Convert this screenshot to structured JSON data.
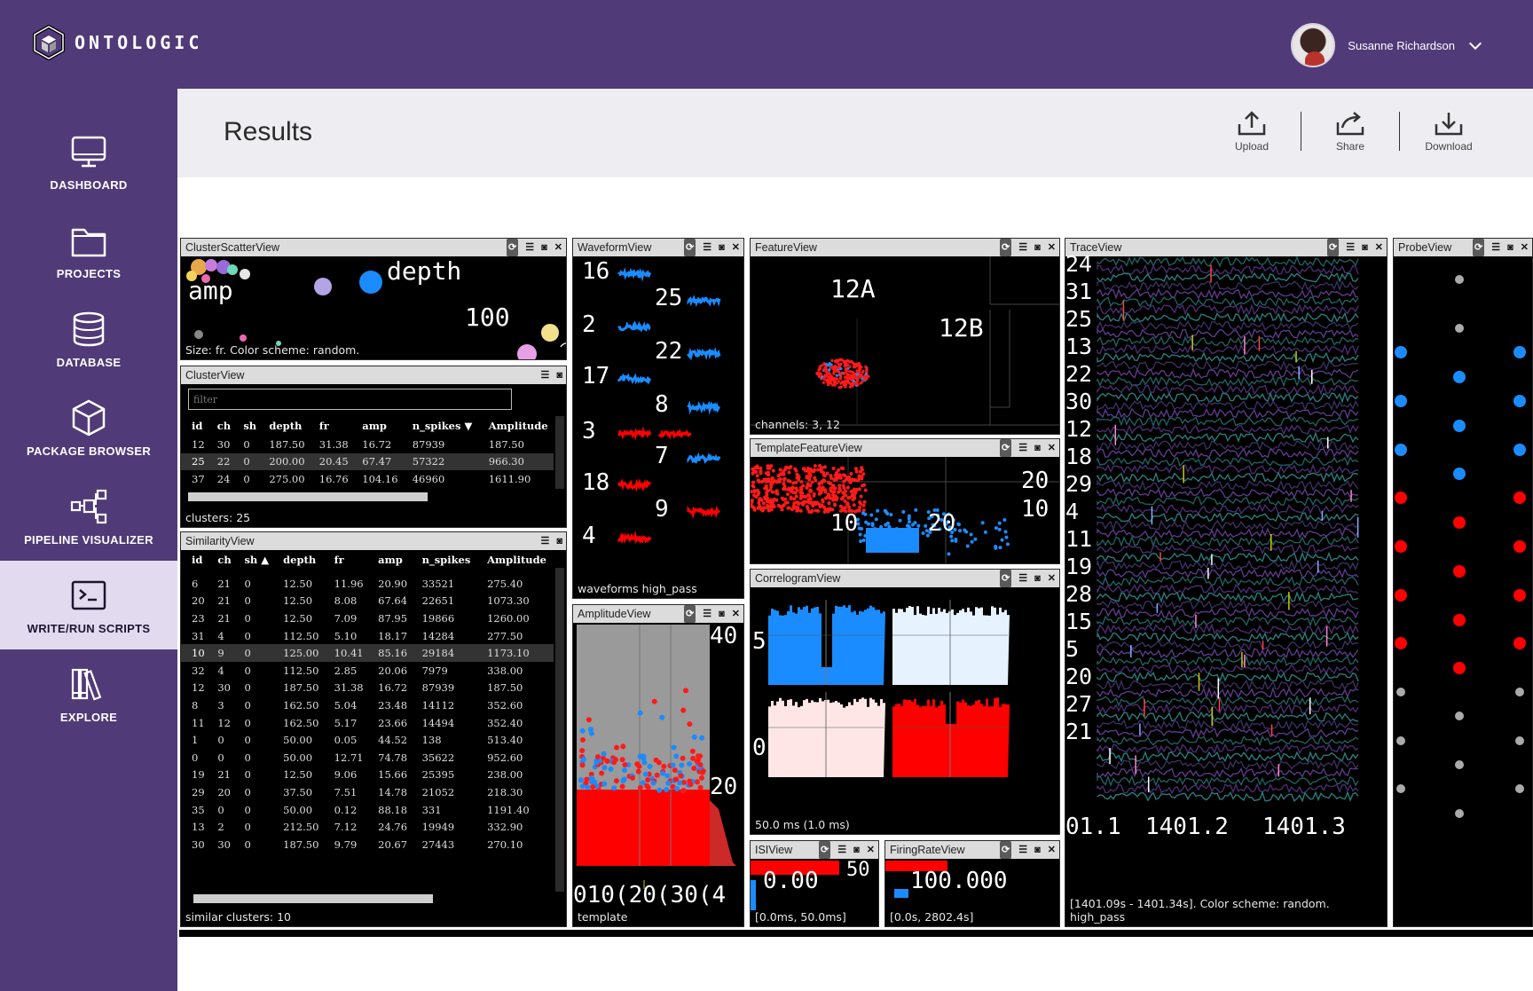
{
  "brand": {
    "name": "ONTOLOGIC"
  },
  "user": {
    "name": "Susanne Richardson"
  },
  "nav": [
    {
      "label": "DASHBOARD",
      "icon": "monitor-icon"
    },
    {
      "label": "PROJECTS",
      "icon": "folder-icon"
    },
    {
      "label": "DATABASE",
      "icon": "database-icon"
    },
    {
      "label": "PACKAGE BROWSER",
      "icon": "box-icon"
    },
    {
      "label": "PIPELINE VISUALIZER",
      "icon": "pipeline-icon"
    },
    {
      "label": "WRITE/RUN SCRIPTS",
      "icon": "terminal-icon",
      "active": true
    },
    {
      "label": "EXPLORE",
      "icon": "library-icon"
    }
  ],
  "page": {
    "title": "Results"
  },
  "actions": {
    "upload": "Upload",
    "share": "Share",
    "download": "Download"
  },
  "panels": {
    "cluster_scatter": {
      "title": "ClusterScatterView",
      "footer": "Size: fr. Color scheme: random.",
      "labels": [
        "depth",
        "amp",
        "100"
      ]
    },
    "cluster": {
      "title": "ClusterView",
      "filter_placeholder": "filter",
      "footer": "clusters: 25",
      "columns": [
        "id",
        "ch",
        "sh",
        "depth",
        "fr",
        "amp",
        "n_spikes ▼",
        "Amplitude"
      ],
      "rows": [
        [
          "12",
          "30",
          "0",
          "187.50",
          "31.38",
          "16.72",
          "87939",
          "187.50"
        ],
        [
          "25",
          "22",
          "0",
          "200.00",
          "20.45",
          "67.47",
          "57322",
          "966.30"
        ],
        [
          "37",
          "24",
          "0",
          "275.00",
          "16.76",
          "104.16",
          "46960",
          "1611.90"
        ]
      ]
    },
    "similarity": {
      "title": "SimilarityView",
      "footer": "similar clusters: 10",
      "columns": [
        "id",
        "ch",
        "sh ▲",
        "depth",
        "fr",
        "amp",
        "n_spikes",
        "Amplitude"
      ],
      "rows": [
        [
          "6",
          "21",
          "0",
          "12.50",
          "11.96",
          "20.90",
          "33521",
          "275.40"
        ],
        [
          "20",
          "21",
          "0",
          "12.50",
          "8.08",
          "67.64",
          "22651",
          "1073.30"
        ],
        [
          "23",
          "21",
          "0",
          "12.50",
          "7.09",
          "87.95",
          "19866",
          "1260.00"
        ],
        [
          "31",
          "4",
          "0",
          "112.50",
          "5.10",
          "18.17",
          "14284",
          "277.50"
        ],
        [
          "10",
          "9",
          "0",
          "125.00",
          "10.41",
          "85.16",
          "29184",
          "1173.10"
        ],
        [
          "32",
          "4",
          "0",
          "112.50",
          "2.85",
          "20.06",
          "7979",
          "338.00"
        ],
        [
          "12",
          "30",
          "0",
          "187.50",
          "31.38",
          "16.72",
          "87939",
          "187.50"
        ],
        [
          "8",
          "3",
          "0",
          "162.50",
          "5.04",
          "23.48",
          "14112",
          "352.60"
        ],
        [
          "11",
          "12",
          "0",
          "162.50",
          "5.17",
          "23.66",
          "14494",
          "352.40"
        ],
        [
          "1",
          "0",
          "0",
          "50.00",
          "0.05",
          "44.52",
          "138",
          "513.40"
        ],
        [
          "0",
          "0",
          "0",
          "50.00",
          "12.71",
          "74.78",
          "35622",
          "952.60"
        ],
        [
          "19",
          "21",
          "0",
          "12.50",
          "9.06",
          "15.66",
          "25395",
          "238.00"
        ],
        [
          "29",
          "20",
          "0",
          "37.50",
          "7.51",
          "14.78",
          "21052",
          "218.30"
        ],
        [
          "35",
          "0",
          "0",
          "50.00",
          "0.12",
          "88.18",
          "331",
          "1191.40"
        ],
        [
          "13",
          "2",
          "0",
          "212.50",
          "7.12",
          "24.76",
          "19949",
          "332.90"
        ],
        [
          "30",
          "30",
          "0",
          "187.50",
          "9.79",
          "20.67",
          "27443",
          "270.10"
        ]
      ]
    },
    "waveform": {
      "title": "WaveformView",
      "footer": "waveforms high_pass",
      "channels": [
        "16",
        "25",
        "2",
        "22",
        "17",
        "8",
        "3",
        "7",
        "18",
        "9",
        "4"
      ]
    },
    "feature": {
      "title": "FeatureView",
      "footer": "channels: 3, 12",
      "labels": [
        "12A",
        "12B"
      ]
    },
    "template_feature": {
      "title": "TemplateFeatureView",
      "labels": [
        "20",
        "10",
        "10",
        "20"
      ]
    },
    "amplitude": {
      "title": "AmplitudeView",
      "footer": "template",
      "labels": [
        "40",
        "20"
      ],
      "axis": "010(20(30(4"
    },
    "correlogram": {
      "title": "CorrelogramView",
      "footer": "50.0 ms (1.0 ms)",
      "labels": [
        "5",
        "0"
      ]
    },
    "isi": {
      "title": "ISIView",
      "footer": "[0.0ms, 50.0ms]",
      "labels": [
        "0.00",
        "50"
      ]
    },
    "firing_rate": {
      "title": "FiringRateView",
      "footer": "[0.0s, 2802.4s]",
      "labels": [
        "100.000"
      ]
    },
    "trace": {
      "title": "TraceView",
      "footer": "[1401.09s - 1401.34s]. Color scheme: random. high_pass",
      "channels": [
        "24",
        "31",
        "25",
        "13",
        "22",
        "30",
        "12",
        "18",
        "29",
        "4",
        "11",
        "19",
        "28",
        "15",
        "5",
        "20",
        "27",
        "21"
      ],
      "ticks": [
        "01.1",
        "1401.2",
        "1401.3"
      ]
    },
    "probe": {
      "title": "ProbeView"
    }
  },
  "colors": {
    "purple": "#503a78",
    "blue": "#1a8cff",
    "red": "#ff0000"
  }
}
